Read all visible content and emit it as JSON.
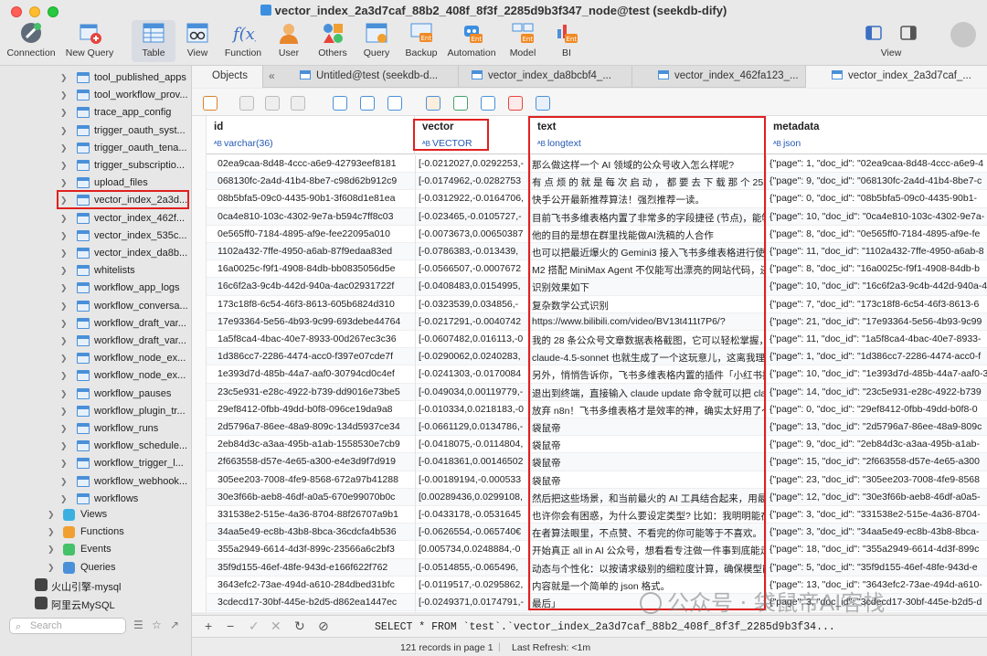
{
  "window": {
    "title": "vector_index_2a3d7caf_88b2_408f_8f3f_2285d9b3f347_node@test (seekdb-dify)"
  },
  "toolbar": {
    "connection": "Connection",
    "new_query": "New Query",
    "table": "Table",
    "view": "View",
    "function": "Function",
    "user": "User",
    "others": "Others",
    "query": "Query",
    "backup": "Backup",
    "automation": "Automation",
    "model": "Model",
    "bi": "BI",
    "view_right": "View"
  },
  "sidebar": {
    "tables": [
      "tool_published_apps",
      "tool_workflow_prov...",
      "trace_app_config",
      "trigger_oauth_syst...",
      "trigger_oauth_tena...",
      "trigger_subscriptio...",
      "upload_files",
      "vector_index_2a3d...",
      "vector_index_462f...",
      "vector_index_535c...",
      "vector_index_da8b...",
      "whitelists",
      "workflow_app_logs",
      "workflow_conversa...",
      "workflow_draft_var...",
      "workflow_draft_var...",
      "workflow_node_ex...",
      "workflow_node_ex...",
      "workflow_pauses",
      "workflow_plugin_tr...",
      "workflow_runs",
      "workflow_schedule...",
      "workflow_trigger_l...",
      "workflow_webhook...",
      "workflows"
    ],
    "groups": [
      "Views",
      "Functions",
      "Events",
      "Queries"
    ],
    "connections": [
      "火山引擎-mysql",
      "阿里云MySQL"
    ],
    "search_placeholder": "Search"
  },
  "tabs": {
    "objects": "Objects",
    "items": [
      "Untitled@test (seekdb-d...",
      "vector_index_da8bcbf4_...",
      "vector_index_462fa123_...",
      "vector_index_2a3d7caf_..."
    ]
  },
  "grid": {
    "columns": [
      {
        "name": "id",
        "type": "varchar(36)"
      },
      {
        "name": "vector",
        "type": "VECTOR"
      },
      {
        "name": "text",
        "type": "longtext"
      },
      {
        "name": "metadata",
        "type": "json"
      }
    ],
    "rows": [
      [
        "02ea9caa-8d48-4ccc-a6e9-42793eef8181",
        "[-0.0212027,0.0292253,-",
        "那么做这样一个 AI 领域的公众号收入怎么样呢?",
        "{\"page\": 1, \"doc_id\": \"02ea9caa-8d48-4ccc-a6e9-4"
      ],
      [
        "068130fc-2a4d-41b4-8be7-c98d62b912c9",
        "[-0.0174962,-0.0282753",
        "有 点 烦 的 就 是 每 次 启 动 ， 都 要 去 下 载 那 个 253.6M",
        "{\"page\": 9, \"doc_id\": \"068130fc-2a4d-41b4-8be7-c"
      ],
      [
        "08b5bfa5-09c0-4435-90b1-3f608d1e81ea",
        "[-0.0312922,-0.0164706,",
        "快手公开最新推荐算法！强烈推荐一读。",
        "{\"page\": 0, \"doc_id\": \"08b5bfa5-09c0-4435-90b1-"
      ],
      [
        "0ca4e810-103c-4302-9e7a-b594c7ff8c03",
        "[-0.023465,-0.0105727,-",
        "目前飞书多维表格内置了非常多的字段捷径 (节点)，能够满",
        "{\"page\": 10, \"doc_id\": \"0ca4e810-103c-4302-9e7a-"
      ],
      [
        "0e565ff0-7184-4895-af9e-fee22095a010",
        "[-0.0073673,0.00650387",
        "他的目的是想在群里找能做AI洗稿的人合作",
        "{\"page\": 8, \"doc_id\": \"0e565ff0-7184-4895-af9e-fe"
      ],
      [
        "1102a432-7ffe-4950-a6ab-87f9edaa83ed",
        "[-0.0786383,-0.013439,",
        "也可以把最近爆火的 Gemini3 接入飞书多维表格进行使用～",
        "{\"page\": 11, \"doc_id\": \"1102a432-7ffe-4950-a6ab-8"
      ],
      [
        "16a0025c-f9f1-4908-84db-bb0835056d5e",
        "[-0.0566507,-0.0007672",
        "M2 搭配 MiniMax Agent 不仅能写出漂亮的网站代码，还能",
        "{\"page\": 8, \"doc_id\": \"16a0025c-f9f1-4908-84db-b"
      ],
      [
        "16c6f2a3-9c4b-442d-940a-4ac02931722f",
        "[-0.0408483,0.0154995,",
        "识别效果如下",
        "{\"page\": 10, \"doc_id\": \"16c6f2a3-9c4b-442d-940a-4"
      ],
      [
        "173c18f8-6c54-46f3-8613-605b6824d310",
        "[-0.0323539,0.034856,-",
        "复杂数学公式识别",
        "{\"page\": 7, \"doc_id\": \"173c18f8-6c54-46f3-8613-6"
      ],
      [
        "17e93364-5e56-4b93-9c99-693debe44764",
        "[-0.0217291,-0.0040742",
        "https://www.bilibili.com/video/BV13t411t7P6/?",
        "{\"page\": 21, \"doc_id\": \"17e93364-5e56-4b93-9c99"
      ],
      [
        "1a5f8ca4-4bac-40e7-8933-00d267ec3c36",
        "[-0.0607482,0.016113,-0",
        "我的 28 条公众号文章数据表格截图，它可以轻松掌握，把里",
        "{\"page\": 11, \"doc_id\": \"1a5f8ca4-4bac-40e7-8933-"
      ],
      [
        "1d386cc7-2286-4474-acc0-f397e07cde7f",
        "[-0.0290062,0.0240283,",
        "claude-4.5-sonnet 也就生成了一个这玩意儿，这离我理想",
        "{\"page\": 1, \"doc_id\": \"1d386cc7-2286-4474-acc0-f"
      ],
      [
        "1e393d7d-485b-44a7-aaf0-30794cd0c4ef",
        "[-0.0241303,-0.0170084",
        "另外，悄悄告诉你，飞书多维表格内置的插件「小红书插件工",
        "{\"page\": 10, \"doc_id\": \"1e393d7d-485b-44a7-aaf0-3"
      ],
      [
        "23c5e931-e28c-4922-b739-dd9016e73be5",
        "[-0.049034,0.00119779,-",
        "退出到终端，直接输入 claude update 命令就可以把 claude",
        "{\"page\": 14, \"doc_id\": \"23c5e931-e28c-4922-b739"
      ],
      [
        "29ef8412-0fbb-49dd-b0f8-096ce19da9a8",
        "[-0.010334,0.0218183,-0",
        "放弃 n8n！飞书多维表格才是效率的神，确实太好用了～【保",
        "{\"page\": 0, \"doc_id\": \"29ef8412-0fbb-49dd-b0f8-0"
      ],
      [
        "2d5796a7-86ee-48a9-809c-134d5937ce34",
        "[-0.0661129,0.0134786,-",
        "袋鼠帝",
        "{\"page\": 13, \"doc_id\": \"2d5796a7-86ee-48a9-809c"
      ],
      [
        "2eb84d3c-a3aa-495b-a1ab-1558530e7cb9",
        "[-0.0418075,-0.0114804,",
        "袋鼠帝",
        "{\"page\": 9, \"doc_id\": \"2eb84d3c-a3aa-495b-a1ab-"
      ],
      [
        "2f663558-d57e-4e65-a300-e4e3d9f7d919",
        "[-0.0418361,0.00146502",
        "袋鼠帝",
        "{\"page\": 15, \"doc_id\": \"2f663558-d57e-4e65-a300"
      ],
      [
        "305ee203-7008-4fe9-8568-672a97b41288",
        "[-0.00189194,-0.000533",
        "袋鼠帝",
        "{\"page\": 23, \"doc_id\": \"305ee203-7008-4fe9-8568"
      ],
      [
        "30e3f66b-aeb8-46df-a0a5-670e99070b0c",
        "[0.00289436,0.0299108,",
        "然后把这些场景，和当前最火的 AI 工具结合起来，用最简单",
        "{\"page\": 12, \"doc_id\": \"30e3f66b-aeb8-46df-a0a5-"
      ],
      [
        "331538e2-515e-4a36-8704-88f26707a9b1",
        "[-0.0433178,-0.0531645",
        "也许你会有困惑，为什么要设定类型? 比如：我明明能在表格",
        "{\"page\": 3, \"doc_id\": \"331538e2-515e-4a36-8704-"
      ],
      [
        "34aa5e49-ec8b-43b8-8bca-36cdcfa4b536",
        "[-0.0626554,-0.065740€",
        "在者算法眼里，不点赞、不看完的你可能等于不喜欢。",
        "{\"page\": 3, \"doc_id\": \"34aa5e49-ec8b-43b8-8bca-"
      ],
      [
        "355a2949-6614-4d3f-899c-23566a6c2bf3",
        "[0.005734,0.0248884,-0",
        "开始真正 all in AI 公众号，想看看专注做一件事到底能走多远",
        "{\"page\": 18, \"doc_id\": \"355a2949-6614-4d3f-899c"
      ],
      [
        "35f9d155-46ef-48fe-943d-e166f622f762",
        "[-0.0514855,-0.065496,",
        "动态与个性化：以按请求级别的细粒度计算，确保模型能持续",
        "{\"page\": 5, \"doc_id\": \"35f9d155-46ef-48fe-943d-e"
      ],
      [
        "3643efc2-73ae-494d-a610-284dbed31bfc",
        "[-0.0119517,-0.0295862,",
        "内容就是一个简单的 json 格式。",
        "{\"page\": 13, \"doc_id\": \"3643efc2-73ae-494d-a610-"
      ],
      [
        "3cdecd17-30bf-445e-b2d5-d862ea1447ec",
        "[-0.0249371,0.0174791,-",
        "最后」",
        "{\"page\": 3, \"doc_id\": \"3cdecd17-30bf-445e-b2d5-d"
      ]
    ]
  },
  "query": {
    "sql": "SELECT * FROM `test`.`vector_index_2a3d7caf_88b2_408f_8f3f_2285d9b3f34..."
  },
  "status": {
    "records": "121 records in page 1",
    "separator": "|",
    "last_refresh": "Last Refresh: <1m"
  },
  "watermark": {
    "text": "公众号 · 袋鼠帝AI客栈"
  },
  "icons": {
    "connection": "plug-icon",
    "new_query": "grid-plus-icon",
    "table": "table-icon",
    "view": "eyeglasses-icon",
    "function": "fx-icon",
    "user": "user-icon",
    "others": "shapes-icon",
    "query": "query-grid-icon",
    "backup": "backup-icon",
    "automation": "robot-icon",
    "model": "model-icon",
    "bi": "chart-icon"
  },
  "colors": {
    "highlight": "#e02020",
    "accent": "#3b8fe0",
    "type_text": "#2458b5"
  }
}
